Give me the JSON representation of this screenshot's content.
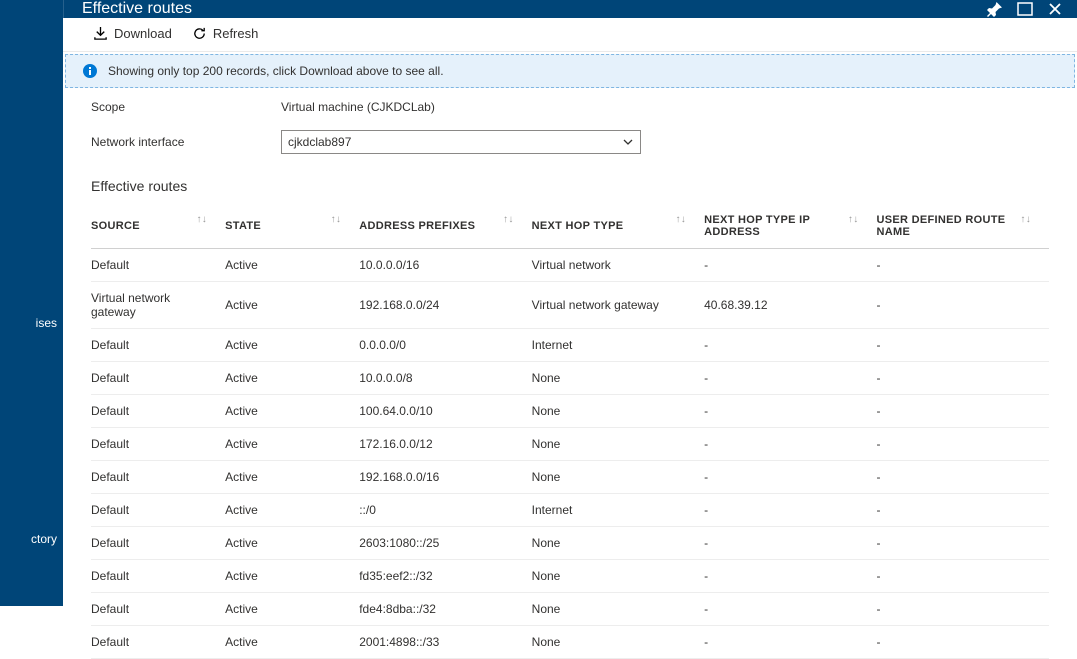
{
  "left_nav": {
    "item1": "ises",
    "item2": "ctory"
  },
  "header": {
    "title": "Effective routes"
  },
  "toolbar": {
    "download": "Download",
    "refresh": "Refresh"
  },
  "info_banner": "Showing only top 200 records, click Download above to see all.",
  "form": {
    "scope_label": "Scope",
    "scope_value": "Virtual machine (CJKDCLab)",
    "nic_label": "Network interface",
    "nic_value": "cjkdclab897"
  },
  "section_title": "Effective routes",
  "table": {
    "columns": {
      "source": "Source",
      "state": "State",
      "prefixes": "Address Prefixes",
      "nexthop_type": "Next Hop Type",
      "nexthop_ip": "Next Hop Type IP Address",
      "udr_name": "User Defined Route Name"
    },
    "rows": [
      {
        "source": "Default",
        "state": "Active",
        "prefixes": "10.0.0.0/16",
        "nexthop_type": "Virtual network",
        "nexthop_ip": "-",
        "udr_name": "-"
      },
      {
        "source": "Virtual network gateway",
        "state": "Active",
        "prefixes": "192.168.0.0/24",
        "nexthop_type": "Virtual network gateway",
        "nexthop_ip": "40.68.39.12",
        "udr_name": "-"
      },
      {
        "source": "Default",
        "state": "Active",
        "prefixes": "0.0.0.0/0",
        "nexthop_type": "Internet",
        "nexthop_ip": "-",
        "udr_name": "-"
      },
      {
        "source": "Default",
        "state": "Active",
        "prefixes": "10.0.0.0/8",
        "nexthop_type": "None",
        "nexthop_ip": "-",
        "udr_name": "-"
      },
      {
        "source": "Default",
        "state": "Active",
        "prefixes": "100.64.0.0/10",
        "nexthop_type": "None",
        "nexthop_ip": "-",
        "udr_name": "-"
      },
      {
        "source": "Default",
        "state": "Active",
        "prefixes": "172.16.0.0/12",
        "nexthop_type": "None",
        "nexthop_ip": "-",
        "udr_name": "-"
      },
      {
        "source": "Default",
        "state": "Active",
        "prefixes": "192.168.0.0/16",
        "nexthop_type": "None",
        "nexthop_ip": "-",
        "udr_name": "-"
      },
      {
        "source": "Default",
        "state": "Active",
        "prefixes": "::/0",
        "nexthop_type": "Internet",
        "nexthop_ip": "-",
        "udr_name": "-"
      },
      {
        "source": "Default",
        "state": "Active",
        "prefixes": "2603:1080::/25",
        "nexthop_type": "None",
        "nexthop_ip": "-",
        "udr_name": "-"
      },
      {
        "source": "Default",
        "state": "Active",
        "prefixes": "fd35:eef2::/32",
        "nexthop_type": "None",
        "nexthop_ip": "-",
        "udr_name": "-"
      },
      {
        "source": "Default",
        "state": "Active",
        "prefixes": "fde4:8dba::/32",
        "nexthop_type": "None",
        "nexthop_ip": "-",
        "udr_name": "-"
      },
      {
        "source": "Default",
        "state": "Active",
        "prefixes": "2001:4898::/33",
        "nexthop_type": "None",
        "nexthop_ip": "-",
        "udr_name": "-"
      }
    ]
  }
}
